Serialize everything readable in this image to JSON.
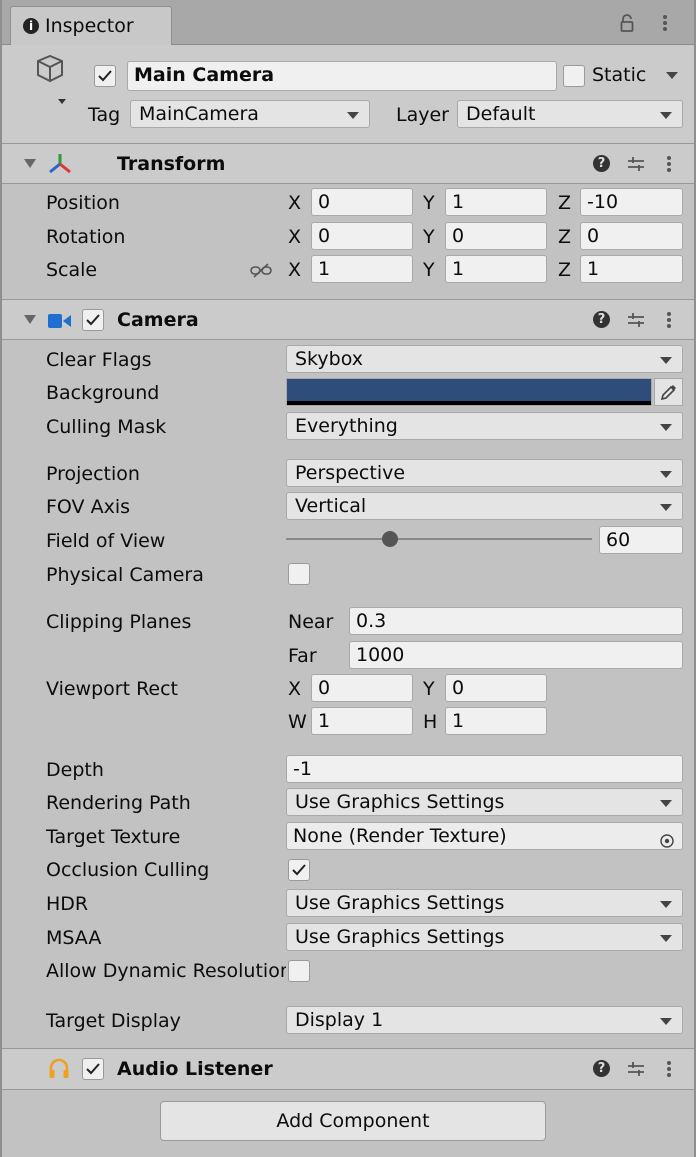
{
  "tab": {
    "icon": "info-icon",
    "title": "Inspector"
  },
  "object": {
    "name": "Main Camera",
    "active": true,
    "static_label": "Static",
    "static": false,
    "tag_label": "Tag",
    "tag_value": "MainCamera",
    "layer_label": "Layer",
    "layer_value": "Default"
  },
  "transform": {
    "title": "Transform",
    "position": {
      "label": "Position",
      "x": "0",
      "y": "1",
      "z": "-10"
    },
    "rotation": {
      "label": "Rotation",
      "x": "0",
      "y": "0",
      "z": "0"
    },
    "scale": {
      "label": "Scale",
      "x": "1",
      "y": "1",
      "z": "1"
    },
    "axis": {
      "x": "X",
      "y": "Y",
      "z": "Z"
    }
  },
  "camera": {
    "title": "Camera",
    "enabled": true,
    "clear_flags": {
      "label": "Clear Flags",
      "value": "Skybox"
    },
    "background": {
      "label": "Background",
      "color": "#2f4d7a"
    },
    "culling_mask": {
      "label": "Culling Mask",
      "value": "Everything"
    },
    "projection": {
      "label": "Projection",
      "value": "Perspective"
    },
    "fov_axis": {
      "label": "FOV Axis",
      "value": "Vertical"
    },
    "field_of_view": {
      "label": "Field of View",
      "value": "60",
      "slider_fraction": 0.34
    },
    "physical_camera": {
      "label": "Physical Camera",
      "checked": false
    },
    "clipping": {
      "label": "Clipping Planes",
      "near_label": "Near",
      "near": "0.3",
      "far_label": "Far",
      "far": "1000"
    },
    "viewport": {
      "label": "Viewport Rect",
      "x_label": "X",
      "x": "0",
      "y_label": "Y",
      "y": "0",
      "w_label": "W",
      "w": "1",
      "h_label": "H",
      "h": "1"
    },
    "depth": {
      "label": "Depth",
      "value": "-1"
    },
    "rendering_path": {
      "label": "Rendering Path",
      "value": "Use Graphics Settings"
    },
    "target_texture": {
      "label": "Target Texture",
      "value": "None (Render Texture)"
    },
    "occlusion": {
      "label": "Occlusion Culling",
      "checked": true
    },
    "hdr": {
      "label": "HDR",
      "value": "Use Graphics Settings"
    },
    "msaa": {
      "label": "MSAA",
      "value": "Use Graphics Settings"
    },
    "dynamic_res": {
      "label": "Allow Dynamic Resolution",
      "checked": false
    },
    "target_display": {
      "label": "Target Display",
      "value": "Display 1"
    }
  },
  "audio_listener": {
    "title": "Audio Listener",
    "enabled": true
  },
  "add_component_label": "Add Component",
  "colors": {
    "background": "#2f4d7a",
    "camera_icon": "#1f6fd1",
    "headphones_icon": "#f0a020"
  }
}
